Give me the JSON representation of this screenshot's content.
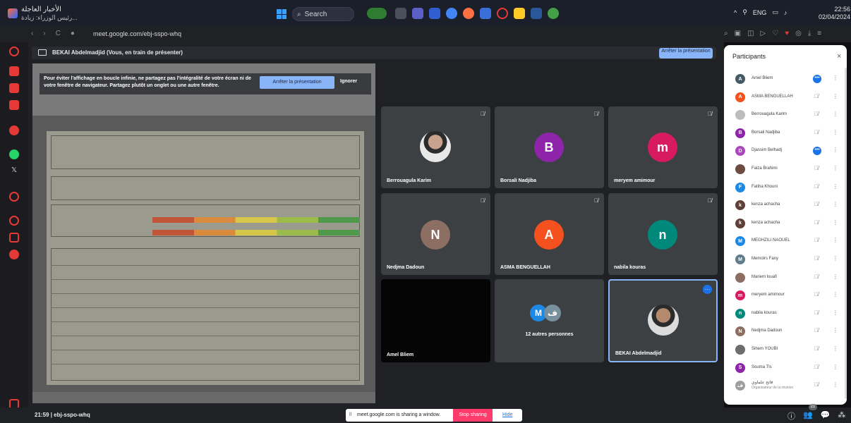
{
  "taskbar": {
    "news_title": "الأخبار العاجلة",
    "news_sub": "رئيس الوزراء: زيادة...",
    "search_placeholder": "Search",
    "tray_lang": "ENG",
    "clock_time": "22:56",
    "clock_date": "02/04/2024"
  },
  "browser": {
    "url": "meet.google.com/ebj-sspo-whq"
  },
  "presentation": {
    "banner": "BEKAI Abdelmadjid (Vous, en train de présenter)",
    "stop_button": "Arrêter la présentation",
    "warning_text": "Pour éviter l'affichage en boucle infinie, ne partagez pas l'intégralité de votre écran ni de votre fenêtre de navigateur. Partagez plutôt un onglet ou une autre fenêtre.",
    "warning_stop": "Arrêter la présentation",
    "warning_ignore": "Ignorer"
  },
  "tiles": [
    {
      "name": "Berrouagula Karim",
      "type": "photo"
    },
    {
      "name": "Borsali Nadjiba",
      "initial": "B",
      "color": "#8e24aa"
    },
    {
      "name": "meryem amimour",
      "initial": "m",
      "color": "#d81b60"
    },
    {
      "name": "Nedjma Dadoun",
      "initial": "N",
      "color": "#8d6e63"
    },
    {
      "name": "ASMA BENGUELLAH",
      "initial": "A",
      "color": "#f4511e"
    },
    {
      "name": "nabila kouras",
      "initial": "n",
      "color": "#00897b"
    },
    {
      "name": "Amel Bliem",
      "type": "video"
    },
    {
      "name": "12 autres personnes",
      "initials": [
        "M",
        "ف"
      ]
    },
    {
      "name": "BEKAI Abdelmadjid",
      "type": "photo"
    }
  ],
  "panel": {
    "title": "Participants",
    "close": "×",
    "participants": [
      {
        "name": "Amel Bliem",
        "initial": "A",
        "color": "#455a64",
        "speaking": true
      },
      {
        "name": "ASMA BENGUELLAH",
        "initial": "A",
        "color": "#f4511e"
      },
      {
        "name": "Berrouagula Karim",
        "initial": "",
        "color": "#bdbdbd"
      },
      {
        "name": "Borsali Nadjiba",
        "initial": "B",
        "color": "#8e24aa"
      },
      {
        "name": "Djassim Belhadj",
        "initial": "D",
        "color": "#ab47bc",
        "speaking": true
      },
      {
        "name": "Faiza Brahimi",
        "initial": "",
        "color": "#6d4c41"
      },
      {
        "name": "Fatiha Khouni",
        "initial": "F",
        "color": "#1e88e5"
      },
      {
        "name": "kenza achacha",
        "initial": "k",
        "color": "#5d4037"
      },
      {
        "name": "kenza achacha",
        "initial": "k",
        "color": "#5d4037"
      },
      {
        "name": "MEGHZILI NAOUEL",
        "initial": "M",
        "color": "#1e88e5"
      },
      {
        "name": "Memoirs Fany",
        "initial": "M",
        "color": "#607d8b"
      },
      {
        "name": "Mariem louafi",
        "initial": "",
        "color": "#8d6e63"
      },
      {
        "name": "meryem amimour",
        "initial": "m",
        "color": "#d81b60"
      },
      {
        "name": "nabila kouras",
        "initial": "n",
        "color": "#00897b"
      },
      {
        "name": "Nedjma Dadoun",
        "initial": "N",
        "color": "#8d6e63"
      },
      {
        "name": "Sihem YOUBI",
        "initial": "",
        "color": "#6d6d6d"
      },
      {
        "name": "Souma Tls",
        "initial": "S",
        "color": "#8e24aa"
      },
      {
        "name": "فاتح علماوي",
        "initial": "ف",
        "color": "#9e9e9e",
        "role": "Organisateur de la réunion"
      }
    ]
  },
  "bottom": {
    "time": "21:59",
    "meeting_code": "ebj-sspo-whq",
    "share_text": "meet.google.com is sharing a window.",
    "stop_sharing": "Stop sharing",
    "hide": "Hide",
    "people_count": "21"
  }
}
